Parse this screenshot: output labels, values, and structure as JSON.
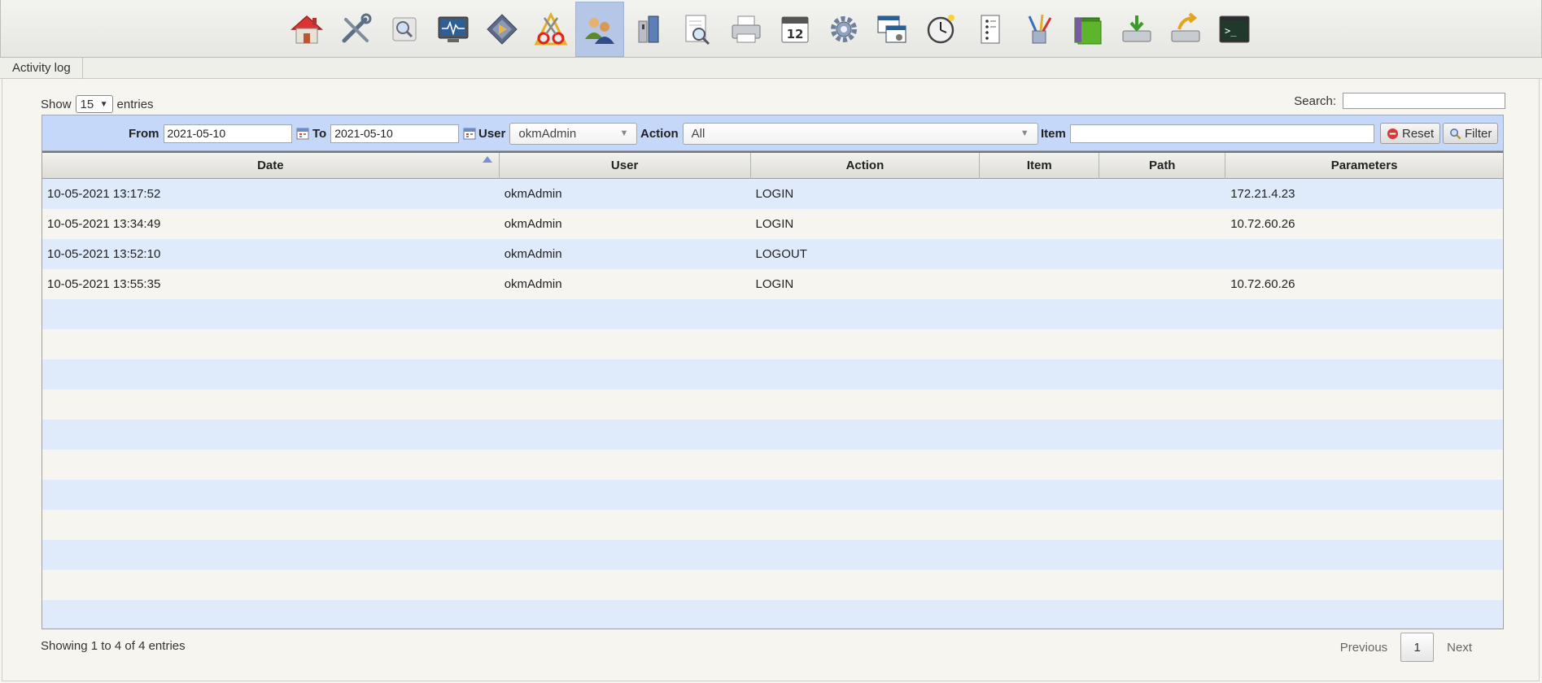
{
  "toolbar": {
    "icons": [
      "home-icon",
      "tools-icon",
      "search-icon",
      "monitor-icon",
      "diamond-icon",
      "scissors-ruler-icon",
      "users-icon",
      "archive-icon",
      "magnifier-document-icon",
      "printer-icon",
      "calendar-icon",
      "gear-icon",
      "windows-icon",
      "clock-icon",
      "list-icon",
      "pens-icon",
      "folder-icon",
      "import-icon",
      "export-icon",
      "terminal-icon"
    ],
    "active": "users-icon",
    "calendar_day": "12"
  },
  "breadcrumb": {
    "label": "Activity log"
  },
  "length": {
    "show": "Show",
    "value": "15",
    "entries": "entries"
  },
  "search": {
    "label": "Search:",
    "value": ""
  },
  "filter": {
    "from_label": "From",
    "from_value": "2021-05-10",
    "to_label": "To",
    "to_value": "2021-05-10",
    "user_label": "User",
    "user_value": "okmAdmin",
    "action_label": "Action",
    "action_value": "All",
    "item_label": "Item",
    "item_value": "",
    "reset_label": "Reset",
    "filter_label": "Filter"
  },
  "table": {
    "headers": [
      "Date",
      "User",
      "Action",
      "Item",
      "Path",
      "Parameters"
    ],
    "rows": [
      [
        "10-05-2021 13:17:52",
        "okmAdmin",
        "LOGIN",
        "",
        "",
        "172.21.4.23"
      ],
      [
        "10-05-2021 13:34:49",
        "okmAdmin",
        "LOGIN",
        "",
        "",
        "10.72.60.26"
      ],
      [
        "10-05-2021 13:52:10",
        "okmAdmin",
        "LOGOUT",
        "",
        "",
        ""
      ],
      [
        "10-05-2021 13:55:35",
        "okmAdmin",
        "LOGIN",
        "",
        "",
        "10.72.60.26"
      ]
    ]
  },
  "footer": {
    "info": "Showing 1 to 4 of 4 entries",
    "previous": "Previous",
    "page": "1",
    "next": "Next"
  },
  "colors": {
    "accent": "#c6d8fa",
    "row_odd": "#dfeafb",
    "row_even": "#f6f5ef"
  }
}
